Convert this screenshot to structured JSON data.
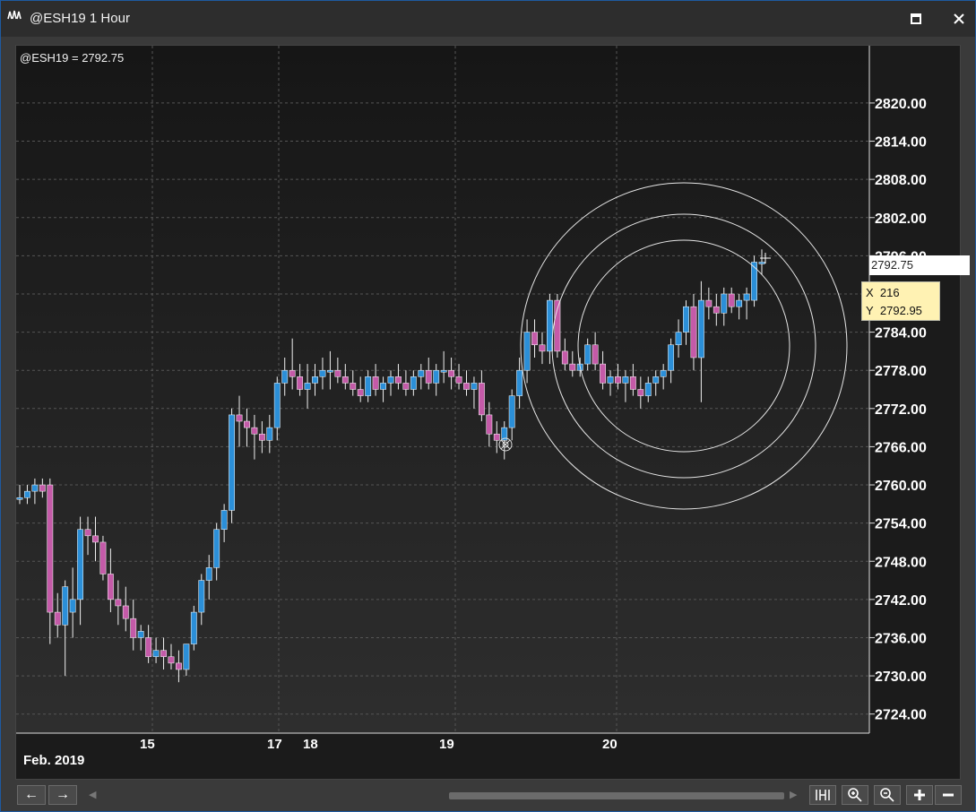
{
  "window": {
    "title": "@ESH19 1 Hour",
    "maximize_icon": "maximize-icon",
    "close_icon": "close-icon"
  },
  "chart": {
    "symbol_label": "@ESH19 = 2792.75",
    "last_price_flag": "2792.75",
    "crosshair": {
      "x_label": "X",
      "x_value": "216",
      "y_label": "Y",
      "y_value": "2792.95"
    },
    "x_ticks": [
      "15",
      "17",
      "18",
      "19",
      "20"
    ],
    "month_label": "Feb. 2019"
  },
  "chart_data": {
    "type": "candlestick",
    "y_ticks": [
      "2820.00",
      "2814.00",
      "2808.00",
      "2802.00",
      "2796.00",
      "2790.00",
      "2784.00",
      "2778.00",
      "2772.00",
      "2766.00",
      "2760.00",
      "2754.00",
      "2748.00",
      "2742.00",
      "2736.00",
      "2730.00",
      "2724.00"
    ],
    "ylim": [
      2721,
      2829
    ],
    "bull_color": "#2b8fd8",
    "bear_color": "#c45aa8",
    "candles": [
      [
        2758,
        2760,
        2757,
        2758
      ],
      [
        2758,
        2760,
        2757,
        2759
      ],
      [
        2759,
        2761,
        2757,
        2760
      ],
      [
        2760,
        2761,
        2758,
        2759
      ],
      [
        2760,
        2761,
        2735,
        2740
      ],
      [
        2740,
        2743,
        2736,
        2738
      ],
      [
        2738,
        2745,
        2730,
        2744
      ],
      [
        2740,
        2747,
        2736,
        2742
      ],
      [
        2742,
        2755,
        2738,
        2753
      ],
      [
        2753,
        2755,
        2749,
        2752
      ],
      [
        2752,
        2755,
        2748,
        2751
      ],
      [
        2751,
        2752,
        2745,
        2746
      ],
      [
        2746,
        2750,
        2740,
        2742
      ],
      [
        2742,
        2745,
        2738,
        2741
      ],
      [
        2741,
        2744,
        2737,
        2739
      ],
      [
        2739,
        2742,
        2734,
        2736
      ],
      [
        2736,
        2738,
        2734,
        2737
      ],
      [
        2736,
        2738,
        2732,
        2733
      ],
      [
        2733,
        2736,
        2732,
        2734
      ],
      [
        2734,
        2736,
        2731,
        2733
      ],
      [
        2733,
        2735,
        2731,
        2732
      ],
      [
        2732,
        2734,
        2729,
        2731
      ],
      [
        2731,
        2735,
        2730,
        2735
      ],
      [
        2735,
        2741,
        2734,
        2740
      ],
      [
        2740,
        2746,
        2738,
        2745
      ],
      [
        2745,
        2749,
        2742,
        2747
      ],
      [
        2747,
        2754,
        2745,
        2753
      ],
      [
        2753,
        2757,
        2751,
        2756
      ],
      [
        2756,
        2772,
        2754,
        2771
      ],
      [
        2771,
        2774,
        2766,
        2770
      ],
      [
        2770,
        2772,
        2766,
        2769
      ],
      [
        2769,
        2771,
        2764,
        2768
      ],
      [
        2768,
        2770,
        2765,
        2767
      ],
      [
        2767,
        2771,
        2765,
        2769
      ],
      [
        2769,
        2777,
        2767,
        2776
      ],
      [
        2776,
        2780,
        2774,
        2778
      ],
      [
        2778,
        2783,
        2775,
        2777
      ],
      [
        2777,
        2779,
        2774,
        2775
      ],
      [
        2775,
        2779,
        2772,
        2776
      ],
      [
        2776,
        2779,
        2774,
        2777
      ],
      [
        2777,
        2780,
        2775,
        2778
      ],
      [
        2778,
        2781,
        2775,
        2778
      ],
      [
        2778,
        2780,
        2776,
        2777
      ],
      [
        2777,
        2779,
        2775,
        2776
      ],
      [
        2776,
        2778,
        2774,
        2775
      ],
      [
        2775,
        2777,
        2773,
        2774
      ],
      [
        2774,
        2778,
        2773,
        2777
      ],
      [
        2777,
        2779,
        2774,
        2775
      ],
      [
        2775,
        2777,
        2773,
        2776
      ],
      [
        2776,
        2778,
        2774,
        2777
      ],
      [
        2777,
        2779,
        2775,
        2776
      ],
      [
        2776,
        2778,
        2774,
        2775
      ],
      [
        2775,
        2778,
        2774,
        2777
      ],
      [
        2777,
        2779,
        2775,
        2778
      ],
      [
        2778,
        2780,
        2775,
        2776
      ],
      [
        2776,
        2779,
        2774,
        2778
      ],
      [
        2778,
        2781,
        2776,
        2778
      ],
      [
        2778,
        2780,
        2775,
        2777
      ],
      [
        2777,
        2779,
        2775,
        2776
      ],
      [
        2776,
        2778,
        2774,
        2775
      ],
      [
        2775,
        2777,
        2772,
        2776
      ],
      [
        2776,
        2778,
        2770,
        2771
      ],
      [
        2771,
        2773,
        2766,
        2768
      ],
      [
        2768,
        2770,
        2765,
        2767
      ],
      [
        2767,
        2770,
        2764,
        2769
      ],
      [
        2769,
        2775,
        2767,
        2774
      ],
      [
        2774,
        2780,
        2772,
        2778
      ],
      [
        2778,
        2786,
        2776,
        2784
      ],
      [
        2784,
        2786,
        2780,
        2782
      ],
      [
        2782,
        2784,
        2779,
        2781
      ],
      [
        2781,
        2790,
        2779,
        2789
      ],
      [
        2789,
        2790,
        2780,
        2781
      ],
      [
        2781,
        2783,
        2778,
        2779
      ],
      [
        2779,
        2781,
        2777,
        2778
      ],
      [
        2778,
        2780,
        2777,
        2779
      ],
      [
        2779,
        2783,
        2778,
        2782
      ],
      [
        2782,
        2784,
        2778,
        2779
      ],
      [
        2779,
        2781,
        2775,
        2776
      ],
      [
        2776,
        2778,
        2774,
        2777
      ],
      [
        2777,
        2779,
        2775,
        2776
      ],
      [
        2776,
        2778,
        2773,
        2777
      ],
      [
        2777,
        2779,
        2774,
        2775
      ],
      [
        2775,
        2777,
        2772,
        2774
      ],
      [
        2774,
        2777,
        2773,
        2776
      ],
      [
        2776,
        2778,
        2774,
        2777
      ],
      [
        2777,
        2779,
        2775,
        2778
      ],
      [
        2778,
        2783,
        2776,
        2782
      ],
      [
        2782,
        2786,
        2780,
        2784
      ],
      [
        2784,
        2789,
        2782,
        2788
      ],
      [
        2788,
        2790,
        2778,
        2780
      ],
      [
        2780,
        2792,
        2773,
        2789
      ],
      [
        2789,
        2791,
        2786,
        2788
      ],
      [
        2788,
        2790,
        2785,
        2787
      ],
      [
        2787,
        2791,
        2785,
        2790
      ],
      [
        2790,
        2791,
        2787,
        2788
      ],
      [
        2788,
        2790,
        2786,
        2789
      ],
      [
        2789,
        2791,
        2786,
        2790
      ],
      [
        2789,
        2796,
        2788,
        2795
      ],
      [
        2795,
        2797,
        2793,
        2795
      ]
    ]
  },
  "footer": {
    "back_label": "←",
    "forward_label": "→",
    "tools": [
      "bars-icon",
      "zoom-in-icon",
      "zoom-out-icon",
      "plus-icon",
      "minus-icon"
    ]
  }
}
